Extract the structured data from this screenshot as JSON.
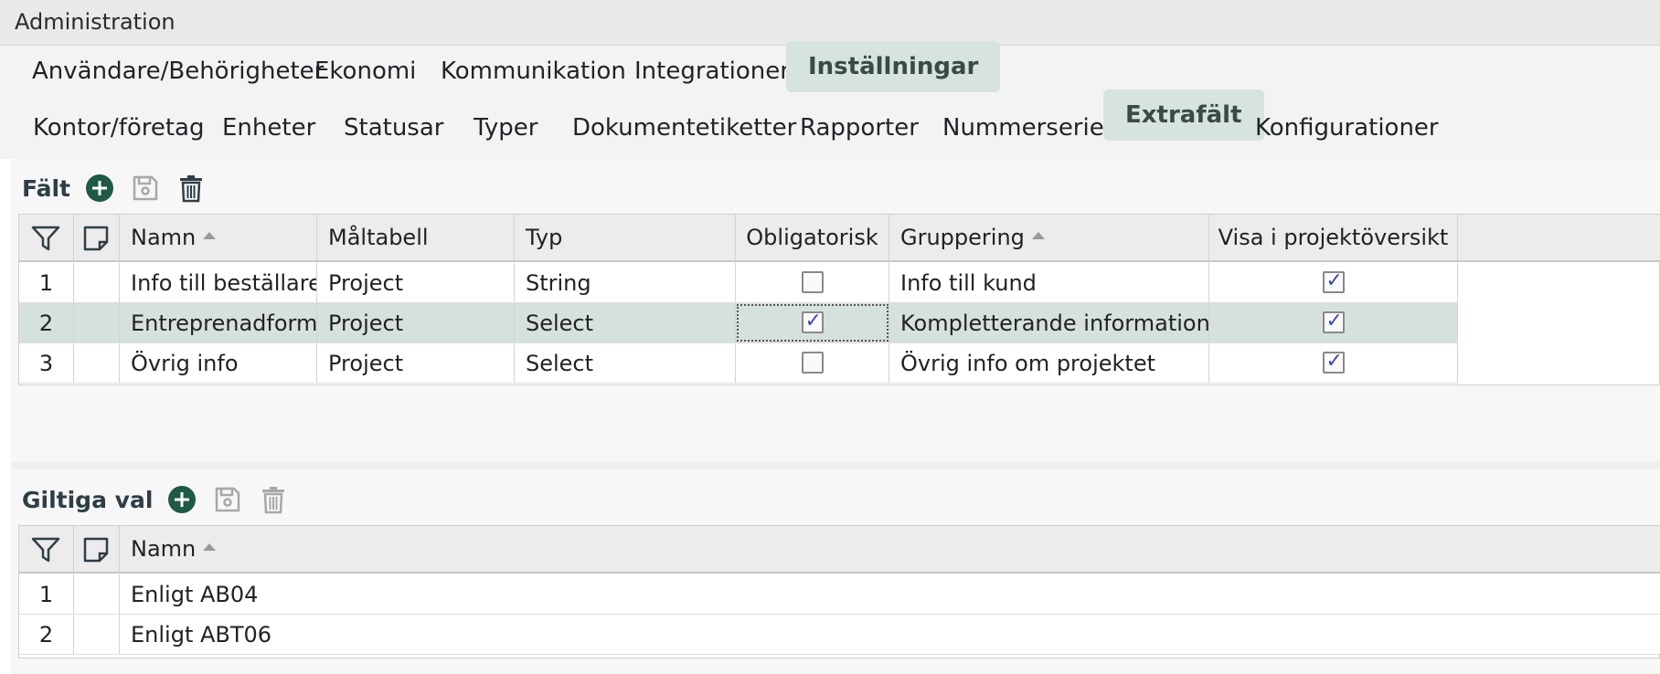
{
  "window": {
    "title": "Administration"
  },
  "tabs_main": [
    {
      "label": "Användare/Behörigheter",
      "active": false
    },
    {
      "label": "Ekonomi",
      "active": false
    },
    {
      "label": "Kommunikation",
      "active": false
    },
    {
      "label": "Integrationer",
      "active": false
    },
    {
      "label": "Inställningar",
      "active": true
    }
  ],
  "tabs_sub": [
    {
      "label": "Kontor/företag",
      "active": false
    },
    {
      "label": "Enheter",
      "active": false
    },
    {
      "label": "Statusar",
      "active": false
    },
    {
      "label": "Typer",
      "active": false
    },
    {
      "label": "Dokumentetiketter",
      "active": false
    },
    {
      "label": "Rapporter",
      "active": false
    },
    {
      "label": "Nummerserier",
      "active": false
    },
    {
      "label": "Extrafält",
      "active": true
    },
    {
      "label": "Konfigurationer",
      "active": false
    }
  ],
  "fields_section": {
    "title": "Fält",
    "icons": [
      "add-icon",
      "save-icon",
      "trash-icon"
    ],
    "columns": [
      "Namn",
      "Måltabell",
      "Typ",
      "Obligatorisk",
      "Gruppering",
      "Visa i projektöversikt"
    ],
    "sorted_columns": [
      "Namn",
      "Gruppering"
    ],
    "rows": [
      {
        "num": "1",
        "namn": "Info till beställare",
        "maltabell": "Project",
        "typ": "String",
        "obligatorisk": false,
        "gruppering": "Info till kund",
        "visa": true,
        "selected": false
      },
      {
        "num": "2",
        "namn": "Entreprenadform",
        "maltabell": "Project",
        "typ": "Select",
        "obligatorisk": true,
        "gruppering": "Kompletterande information",
        "visa": true,
        "selected": true
      },
      {
        "num": "3",
        "namn": "Övrig info",
        "maltabell": "Project",
        "typ": "Select",
        "obligatorisk": false,
        "gruppering": "Övrig info om projektet",
        "visa": true,
        "selected": false
      }
    ]
  },
  "values_section": {
    "title": "Giltiga val",
    "icons": [
      "add-icon",
      "save-icon",
      "trash-icon"
    ],
    "columns": [
      "Namn"
    ],
    "rows": [
      {
        "num": "1",
        "namn": "Enligt AB04"
      },
      {
        "num": "2",
        "namn": "Enligt ABT06"
      }
    ]
  },
  "colors": {
    "accent_green": "#1f5a45",
    "active_tab_bg": "#d7e3dd",
    "selected_row_bg": "#d6e1db"
  }
}
